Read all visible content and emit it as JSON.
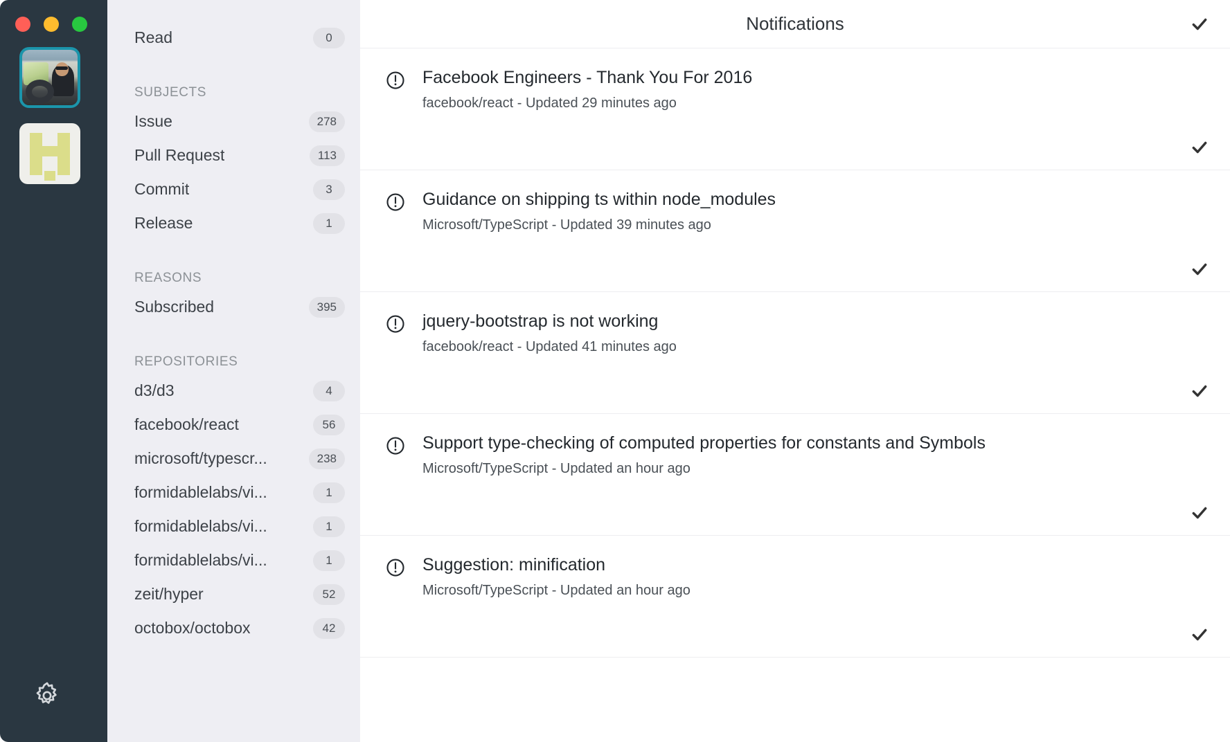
{
  "window": {
    "traffic_lights": [
      {
        "name": "close",
        "color": "#ff5f57"
      },
      {
        "name": "minimize",
        "color": "#febc2e"
      },
      {
        "name": "maximize",
        "color": "#28c840"
      }
    ]
  },
  "rail": {
    "accounts": [
      {
        "name": "account-avatar-photo",
        "type": "photo",
        "selected": true
      },
      {
        "name": "account-avatar-logo",
        "type": "logo",
        "selected": false
      }
    ],
    "settings_icon": "gear-icon"
  },
  "sidebar": {
    "status": [
      {
        "label": "Read",
        "count": "0"
      }
    ],
    "sections": [
      {
        "title": "SUBJECTS",
        "items": [
          {
            "label": "Issue",
            "count": "278"
          },
          {
            "label": "Pull Request",
            "count": "113"
          },
          {
            "label": "Commit",
            "count": "3"
          },
          {
            "label": "Release",
            "count": "1"
          }
        ]
      },
      {
        "title": "REASONS",
        "items": [
          {
            "label": "Subscribed",
            "count": "395"
          }
        ]
      },
      {
        "title": "REPOSITORIES",
        "items": [
          {
            "label": "d3/d3",
            "count": "4"
          },
          {
            "label": "facebook/react",
            "count": "56"
          },
          {
            "label": "microsoft/typescr...",
            "count": "238"
          },
          {
            "label": "formidablelabs/vi...",
            "count": "1"
          },
          {
            "label": "formidablelabs/vi...",
            "count": "1"
          },
          {
            "label": "formidablelabs/vi...",
            "count": "1"
          },
          {
            "label": "zeit/hyper",
            "count": "52"
          },
          {
            "label": "octobox/octobox",
            "count": "42"
          }
        ]
      }
    ]
  },
  "main": {
    "title": "Notifications",
    "mark_all_read_icon": "check-icon",
    "notifications": [
      {
        "icon": "issue-icon",
        "title": "Facebook Engineers - Thank You For 2016",
        "meta": "facebook/react - Updated 29 minutes ago",
        "action_icon": "check-icon"
      },
      {
        "icon": "issue-icon",
        "title": "Guidance on shipping ts within node_modules",
        "meta": "Microsoft/TypeScript - Updated 39 minutes ago",
        "action_icon": "check-icon"
      },
      {
        "icon": "issue-icon",
        "title": "jquery-bootstrap is not working",
        "meta": "facebook/react - Updated 41 minutes ago",
        "action_icon": "check-icon"
      },
      {
        "icon": "issue-icon",
        "title": "Support type-checking of computed properties for constants and Symbols",
        "meta": "Microsoft/TypeScript - Updated an hour ago",
        "action_icon": "check-icon"
      },
      {
        "icon": "issue-icon",
        "title": "Suggestion: minification",
        "meta": "Microsoft/TypeScript - Updated an hour ago",
        "action_icon": "check-icon"
      }
    ]
  },
  "colors": {
    "rail_bg": "#2a3741",
    "sidebar_bg": "#eeeef3",
    "badge_bg": "#e2e2e7",
    "selection_border": "#1b95ab",
    "text_primary": "#24292e",
    "text_muted": "#8c9196",
    "divider": "#ededf0"
  }
}
